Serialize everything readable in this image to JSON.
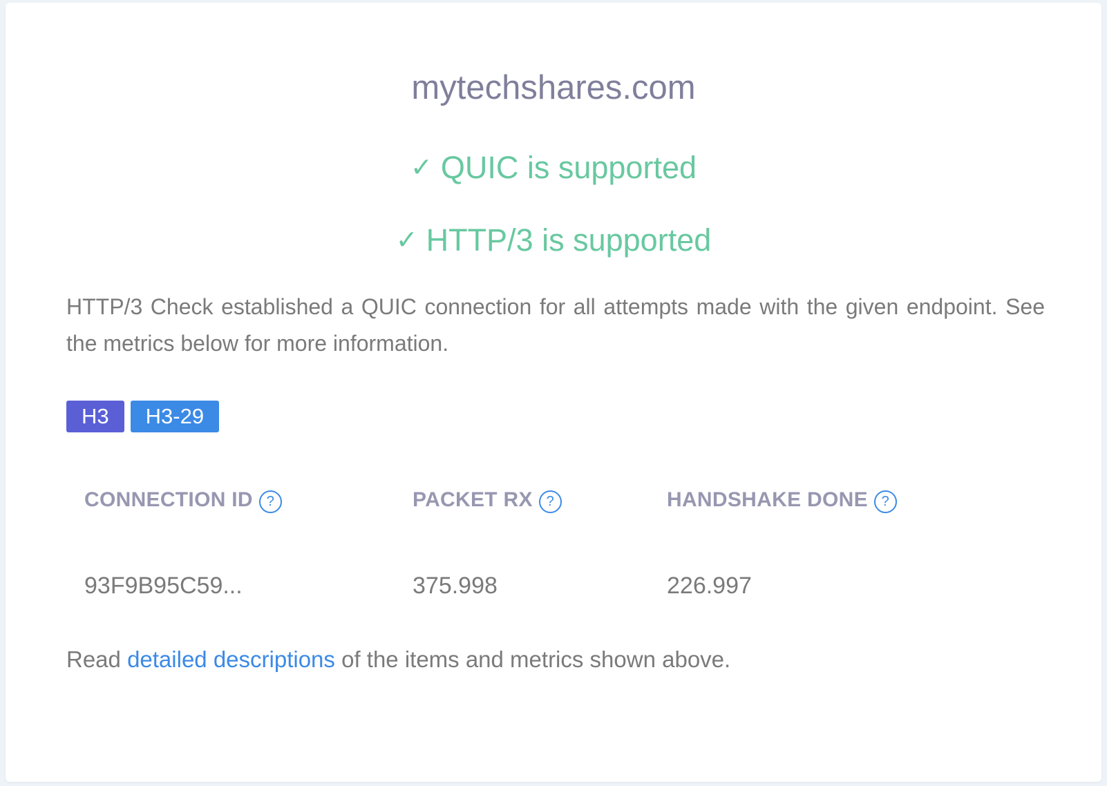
{
  "domain": "mytechshares.com",
  "status": {
    "check_glyph": "✓",
    "quic": "QUIC is supported",
    "http3": "HTTP/3 is supported"
  },
  "summary": "HTTP/3 Check established a QUIC connection for all attempts made with the given endpoint. See the metrics below for more information.",
  "tags": [
    "H3",
    "H3-29"
  ],
  "metrics": [
    {
      "label": "CONNECTION ID",
      "value": "93F9B95C59..."
    },
    {
      "label": "PACKET RX",
      "value": "375.998"
    },
    {
      "label": "HANDSHAKE DONE",
      "value": "226.997"
    }
  ],
  "help_glyph": "?",
  "footer": {
    "prefix": "Read ",
    "link": "detailed descriptions",
    "suffix": " of the items and metrics shown above."
  },
  "colors": {
    "success": "#68c8a0",
    "tag_h3": "#5a5fd6",
    "tag_h329": "#3b8ae6",
    "link": "#3b8ae6"
  }
}
